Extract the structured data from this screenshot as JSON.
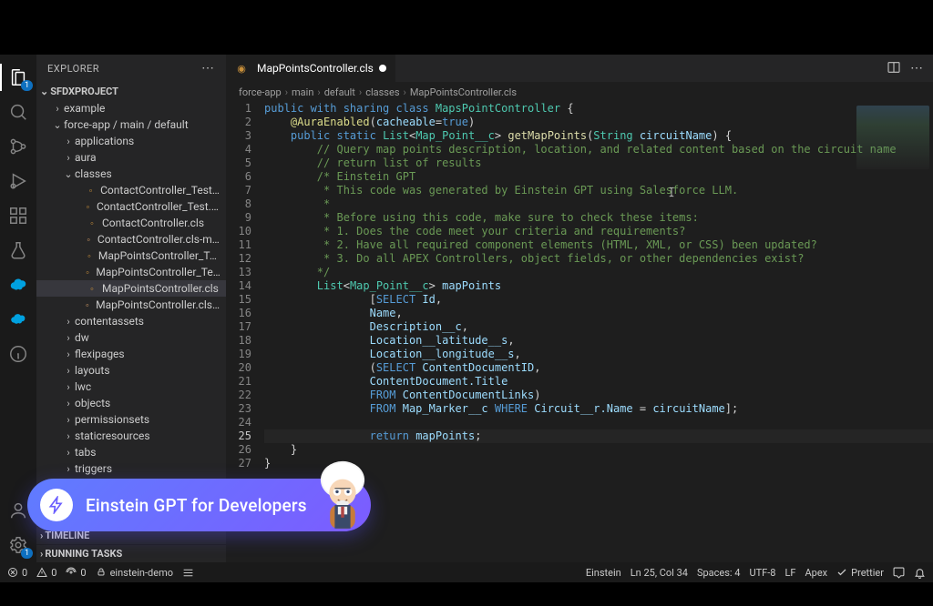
{
  "sidebar": {
    "title": "EXPLORER",
    "project": "SFDXPROJECT",
    "tree": [
      {
        "label": "example",
        "depth": 1,
        "type": "folder",
        "twisty": "›"
      },
      {
        "label": "force-app / main / default",
        "depth": 1,
        "type": "folder",
        "twisty": "⌄"
      },
      {
        "label": "applications",
        "depth": 2,
        "type": "folder",
        "twisty": "›"
      },
      {
        "label": "aura",
        "depth": 2,
        "type": "folder",
        "twisty": "›"
      },
      {
        "label": "classes",
        "depth": 2,
        "type": "folder",
        "twisty": "⌄"
      },
      {
        "label": "ContactController_Test.cls",
        "depth": 3,
        "type": "file"
      },
      {
        "label": "ContactController_Test.cls-met…",
        "depth": 3,
        "type": "file"
      },
      {
        "label": "ContactController.cls",
        "depth": 3,
        "type": "file"
      },
      {
        "label": "ContactController.cls-meta.xml",
        "depth": 3,
        "type": "file"
      },
      {
        "label": "MapPointsController_Test.cls",
        "depth": 3,
        "type": "file"
      },
      {
        "label": "MapPointsController_Test.cls-m…",
        "depth": 3,
        "type": "file"
      },
      {
        "label": "MapPointsController.cls",
        "depth": 3,
        "type": "file",
        "selected": true
      },
      {
        "label": "MapPointsController.cls-meta.xml",
        "depth": 3,
        "type": "file"
      },
      {
        "label": "contentassets",
        "depth": 2,
        "type": "folder",
        "twisty": "›"
      },
      {
        "label": "dw",
        "depth": 2,
        "type": "folder",
        "twisty": "›"
      },
      {
        "label": "flexipages",
        "depth": 2,
        "type": "folder",
        "twisty": "›"
      },
      {
        "label": "layouts",
        "depth": 2,
        "type": "folder",
        "twisty": "›"
      },
      {
        "label": "lwc",
        "depth": 2,
        "type": "folder",
        "twisty": "›"
      },
      {
        "label": "objects",
        "depth": 2,
        "type": "folder",
        "twisty": "›"
      },
      {
        "label": "permissionsets",
        "depth": 2,
        "type": "folder",
        "twisty": "›"
      },
      {
        "label": "staticresources",
        "depth": 2,
        "type": "folder",
        "twisty": "›"
      },
      {
        "label": "tabs",
        "depth": 2,
        "type": "folder",
        "twisty": "›"
      },
      {
        "label": "triggers",
        "depth": 2,
        "type": "folder",
        "twisty": "›"
      }
    ],
    "bottom_sections": [
      "TIMELINE",
      "RUNNING TASKS"
    ]
  },
  "tabs": {
    "active": {
      "label": "MapPointsController.cls",
      "dirty": true
    }
  },
  "breadcrumbs": [
    "force-app",
    "main",
    "default",
    "classes",
    "MapPointsController.cls"
  ],
  "editor": {
    "current_line": 25,
    "lines": [
      {
        "n": 1,
        "segs": [
          [
            "kw",
            "public with sharing class "
          ],
          [
            "type",
            "MapsPointController"
          ],
          [
            "",
            " {"
          ]
        ]
      },
      {
        "n": 2,
        "segs": [
          [
            "",
            "    "
          ],
          [
            "ann",
            "@AuraEnabled"
          ],
          [
            "",
            "("
          ],
          [
            "fld",
            "cacheable"
          ],
          [
            "",
            "="
          ],
          [
            "kw",
            "true"
          ],
          [
            "",
            ")"
          ]
        ]
      },
      {
        "n": 3,
        "segs": [
          [
            "",
            "    "
          ],
          [
            "kw",
            "public static "
          ],
          [
            "type",
            "List"
          ],
          [
            "",
            "<"
          ],
          [
            "type",
            "Map_Point__c"
          ],
          [
            "",
            "> "
          ],
          [
            "fn",
            "getMapPoints"
          ],
          [
            "",
            "("
          ],
          [
            "type",
            "String"
          ],
          [
            "",
            " "
          ],
          [
            "fld",
            "circuitName"
          ],
          [
            "",
            ") {"
          ]
        ]
      },
      {
        "n": 4,
        "segs": [
          [
            "",
            "        "
          ],
          [
            "cm",
            "// Query map points description, location, and related content based on the circuit name"
          ]
        ]
      },
      {
        "n": 5,
        "segs": [
          [
            "",
            "        "
          ],
          [
            "cm",
            "// return list of results"
          ]
        ]
      },
      {
        "n": 6,
        "segs": [
          [
            "",
            "        "
          ],
          [
            "cm",
            "/* Einstein GPT"
          ]
        ]
      },
      {
        "n": 7,
        "segs": [
          [
            "",
            "         "
          ],
          [
            "cm",
            "* This code was generated by Einstein GPT using Salesforce LLM."
          ]
        ]
      },
      {
        "n": 8,
        "segs": [
          [
            "",
            "         "
          ],
          [
            "cm",
            "*"
          ]
        ]
      },
      {
        "n": 9,
        "segs": [
          [
            "",
            "         "
          ],
          [
            "cm",
            "* Before using this code, make sure to check these items:"
          ]
        ]
      },
      {
        "n": 10,
        "segs": [
          [
            "",
            "         "
          ],
          [
            "cm",
            "* 1. Does the code meet your criteria and requirements?"
          ]
        ]
      },
      {
        "n": 11,
        "segs": [
          [
            "",
            "         "
          ],
          [
            "cm",
            "* 2. Have all required component elements (HTML, XML, or CSS) been updated?"
          ]
        ]
      },
      {
        "n": 12,
        "segs": [
          [
            "",
            "         "
          ],
          [
            "cm",
            "* 3. Do all APEX Controllers, object fields, or other dependencies exist?"
          ]
        ]
      },
      {
        "n": 13,
        "segs": [
          [
            "",
            "        "
          ],
          [
            "cm",
            "*/"
          ]
        ]
      },
      {
        "n": 14,
        "segs": [
          [
            "",
            "        "
          ],
          [
            "type",
            "List"
          ],
          [
            "",
            "<"
          ],
          [
            "type",
            "Map_Point__c"
          ],
          [
            "",
            "> "
          ],
          [
            "fld",
            "mapPoints"
          ]
        ]
      },
      {
        "n": 15,
        "segs": [
          [
            "",
            "                ["
          ],
          [
            "kw",
            "SELECT"
          ],
          [
            "",
            " "
          ],
          [
            "fld",
            "Id"
          ],
          [
            "",
            ","
          ]
        ]
      },
      {
        "n": 16,
        "segs": [
          [
            "",
            "                "
          ],
          [
            "fld",
            "Name"
          ],
          [
            "",
            ","
          ]
        ]
      },
      {
        "n": 17,
        "segs": [
          [
            "",
            "                "
          ],
          [
            "fld",
            "Description__c"
          ],
          [
            "",
            ","
          ]
        ]
      },
      {
        "n": 18,
        "segs": [
          [
            "",
            "                "
          ],
          [
            "fld",
            "Location__latitude__s"
          ],
          [
            "",
            ","
          ]
        ]
      },
      {
        "n": 19,
        "segs": [
          [
            "",
            "                "
          ],
          [
            "fld",
            "Location__longitude__s"
          ],
          [
            "",
            ","
          ]
        ]
      },
      {
        "n": 20,
        "segs": [
          [
            "",
            "                ("
          ],
          [
            "kw",
            "SELECT"
          ],
          [
            "",
            " "
          ],
          [
            "fld",
            "ContentDocumentID"
          ],
          [
            "",
            ","
          ]
        ]
      },
      {
        "n": 21,
        "segs": [
          [
            "",
            "                "
          ],
          [
            "fld",
            "ContentDocument.Title"
          ]
        ]
      },
      {
        "n": 22,
        "segs": [
          [
            "",
            "                "
          ],
          [
            "kw",
            "FROM"
          ],
          [
            "",
            " "
          ],
          [
            "fld",
            "ContentDocumentLinks"
          ],
          [
            "",
            ")"
          ]
        ]
      },
      {
        "n": 23,
        "segs": [
          [
            "",
            "                "
          ],
          [
            "kw",
            "FROM"
          ],
          [
            "",
            " "
          ],
          [
            "fld",
            "Map_Marker__c"
          ],
          [
            "",
            " "
          ],
          [
            "kw",
            "WHERE"
          ],
          [
            "",
            " "
          ],
          [
            "fld",
            "Circuit__r.Name"
          ],
          [
            "",
            " = "
          ],
          [
            "fld",
            "circuitName"
          ],
          [
            "",
            "];"
          ]
        ]
      },
      {
        "n": 24,
        "segs": [
          [
            "",
            ""
          ]
        ]
      },
      {
        "n": 25,
        "segs": [
          [
            "",
            "                "
          ],
          [
            "kw",
            "return"
          ],
          [
            "",
            " "
          ],
          [
            "fld",
            "mapPoints"
          ],
          [
            "",
            ";"
          ]
        ]
      },
      {
        "n": 26,
        "segs": [
          [
            "",
            "    }"
          ]
        ]
      },
      {
        "n": 27,
        "segs": [
          [
            "",
            "}"
          ]
        ]
      }
    ]
  },
  "statusbar": {
    "left": {
      "errors": "0",
      "warnings": "0",
      "ports": "0",
      "branch": "einstein-demo"
    },
    "right": {
      "einstein": "Einstein",
      "position": "Ln 25, Col 34",
      "spaces": "Spaces: 4",
      "encoding": "UTF-8",
      "eol": "LF",
      "language": "Apex",
      "prettier": "Prettier"
    }
  },
  "banner": {
    "title": "Einstein GPT for Developers"
  },
  "activity_badge": {
    "explorer": "1",
    "settings": "1"
  }
}
